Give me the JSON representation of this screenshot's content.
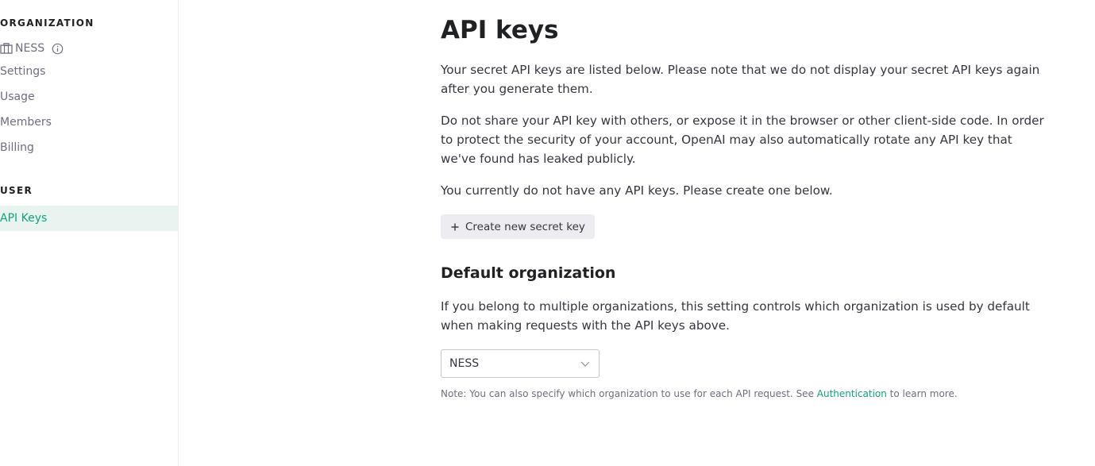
{
  "sidebar": {
    "org_heading": "ORGANIZATION",
    "org_name": "NESS",
    "org_links": [
      "Settings",
      "Usage",
      "Members",
      "Billing"
    ],
    "user_heading": "USER",
    "active_link": "API Keys"
  },
  "main": {
    "title": "API keys",
    "para1": "Your secret API keys are listed below. Please note that we do not display your secret API keys again after you generate them.",
    "para2": "Do not share your API key with others, or expose it in the browser or other client-side code. In order to protect the security of your account, OpenAI may also automatically rotate any API key that we've found has leaked publicly.",
    "para3": "You currently do not have any API keys. Please create one below.",
    "create_button": "Create new secret key",
    "default_org_heading": "Default organization",
    "para4": "If you belong to multiple organizations, this setting controls which organization is used by default when making requests with the API keys above.",
    "org_select_value": "NESS",
    "note_prefix": "Note: You can also specify which organization to use for each API request. See ",
    "note_link": "Authentication",
    "note_suffix": " to learn more."
  },
  "colors": {
    "accent": "#10a37f",
    "active_bg": "#e9f4f1",
    "button_bg": "#ececf1"
  },
  "icons": {
    "org": "building-icon",
    "info": "info-icon",
    "plus": "plus-icon",
    "select": "chevron-down-icon"
  }
}
